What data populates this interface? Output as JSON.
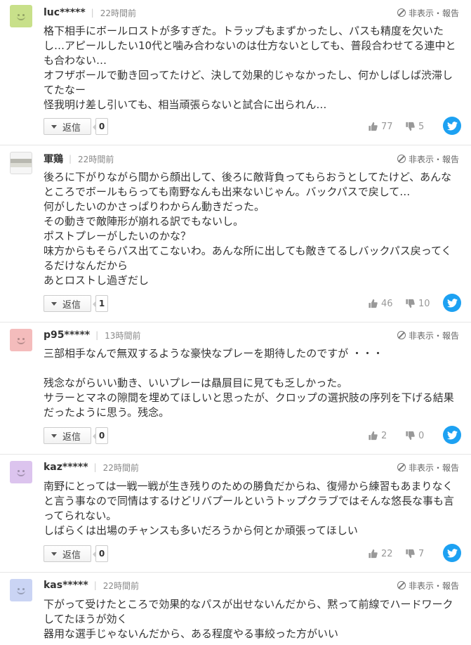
{
  "report_label": "非表示・報告",
  "reply_label": "返信",
  "twitter_color": "#1da1f2",
  "comments": [
    {
      "username": "luc*****",
      "time": "22時間前",
      "avatar_color": "#c8e08a",
      "avatar_icon": "smiley-avatar-icon",
      "text": "格下相手にボールロストが多すぎた。トラップもまずかったし、パスも精度を欠いたし…アピールしたい10代と噛み合わないのは仕方ないとしても、普段合わせてる連中とも合わない…\nオフザボールで動き回ってたけど、決して効果的じゃなかったし、何かしばしば渋滞してたなー\n怪我明け差し引いても、相当頑張らないと試合に出られん…",
      "replies": "0",
      "likes": "77",
      "dislikes": "5"
    },
    {
      "username": "軍鶏",
      "time": "22時間前",
      "avatar_color": "#d8d8d0",
      "avatar_icon": "photo-avatar-icon",
      "text": "後ろに下がりながら間から顔出して、後ろに敵背負ってもらおうとしてたけど、あんなところでボールもらっても南野なんも出来ないじゃん。バックパスで戻して…\n何がしたいのかさっぱりわからん動きだった。\nその動きで敵陣形が崩れる訳でもないし。\nポストプレーがしたいのかな？\n味方からもそらパス出てこないわ。あんな所に出しても敵きてるしバックパス戻ってくるだけなんだから\nあとロストし過ぎだし",
      "replies": "1",
      "likes": "46",
      "dislikes": "10"
    },
    {
      "username": "p95*****",
      "time": "13時間前",
      "avatar_color": "#f4bcbc",
      "avatar_icon": "smiley-avatar-icon",
      "text": "三部相手なんで無双するような豪快なプレーを期待したのですが ・・・\n\n残念ながらいい動き、いいプレーは贔屓目に見ても乏しかった。\nサラーとマネの隙間を埋めてほしいと思ったが、クロップの選択肢の序列を下げる結果だったように思う。残念。",
      "replies": "0",
      "likes": "2",
      "dislikes": "0"
    },
    {
      "username": "kaz*****",
      "time": "22時間前",
      "avatar_color": "#dcc4ee",
      "avatar_icon": "smiley-avatar-icon",
      "text": "南野にとっては一戦一戦が生き残りのための勝負だからね、復帰から練習もあまりなくと言う事なので同情はするけどリバプールというトップクラブではそんな悠長な事も言ってられない。\nしばらくは出場のチャンスも多いだろうから何とか頑張ってほしい",
      "replies": "0",
      "likes": "22",
      "dislikes": "7"
    },
    {
      "username": "kas*****",
      "time": "22時間前",
      "avatar_color": "#cad4f4",
      "avatar_icon": "smiley-avatar-icon",
      "text": "下がって受けたところで効果的なパスが出せないんだから、黙って前線でハードワークしてたほうが効く\n器用な選手じゃないんだから、ある程度やる事絞った方がいい"
    }
  ]
}
